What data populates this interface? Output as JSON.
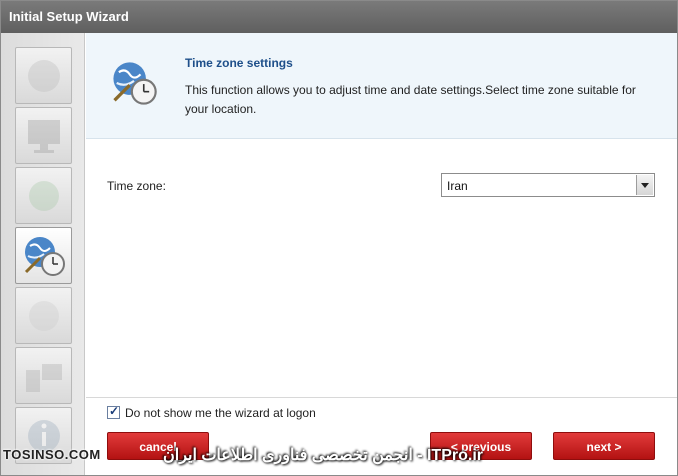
{
  "window": {
    "title": "Initial Setup Wizard"
  },
  "sidebar": {
    "steps": [
      {
        "icon": "wizard-step-1-icon",
        "state": "done"
      },
      {
        "icon": "monitor-icon",
        "state": "done"
      },
      {
        "icon": "network-icon",
        "state": "done"
      },
      {
        "icon": "globe-clock-icon",
        "state": "active"
      },
      {
        "icon": "blank-step-icon",
        "state": "pending"
      },
      {
        "icon": "computer-icon",
        "state": "pending"
      },
      {
        "icon": "info-icon",
        "state": "pending"
      }
    ]
  },
  "header": {
    "icon": "globe-clock-icon",
    "title": "Time zone settings",
    "description": "This function allows you to adjust time and date settings.Select time zone suitable for your location."
  },
  "form": {
    "timezone_label": "Time zone:",
    "timezone_value": "Iran"
  },
  "footer": {
    "checkbox_label": "Do not show me the wizard at logon",
    "checkbox_checked": true,
    "cancel_label": "cancel",
    "previous_label": "< previous",
    "next_label": "next >"
  },
  "watermark": {
    "left_text": "TOSINSO.COM",
    "center_text": "انجمن تخصصی فناوری اطلاعات ایران - ITPro.ir"
  },
  "colors": {
    "titlebar": "#6b6b6b",
    "header_bg": "#eff6fb",
    "title_blue": "#1e4f8a",
    "button_red": "#c91f1f"
  }
}
